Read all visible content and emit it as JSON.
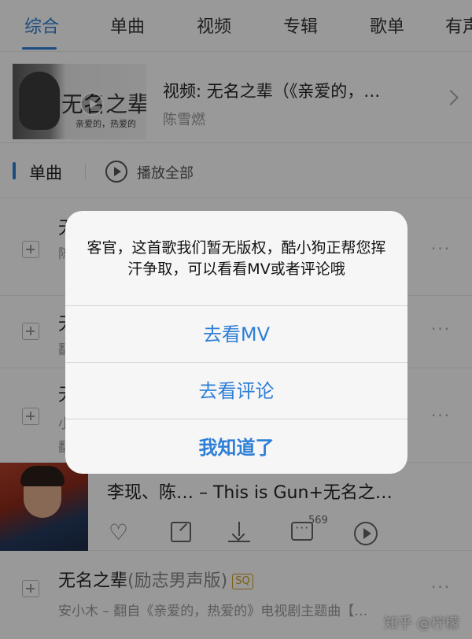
{
  "tabs": [
    "综合",
    "单曲",
    "视频",
    "专辑",
    "歌单",
    "有声"
  ],
  "video": {
    "thumb_title": "无名之辈",
    "thumb_subtitle": "亲爱的，热爱的",
    "title": "视频: 无名之辈（《亲爱的，…",
    "artist": "陈雪燃"
  },
  "section": {
    "title": "单曲",
    "play_all": "播放全部"
  },
  "songs": [
    {
      "title": "无",
      "sub": "陈"
    },
    {
      "title": "无",
      "sub": "翻"
    },
    {
      "title": "无",
      "sub": "小",
      "sub2": "翻"
    },
    {
      "title": "无名之辈",
      "title_suffix": "(励志男声版)",
      "badge": "SQ",
      "sub": "安小木 – 翻自《亲爱的，热爱的》电视剧主题曲【…"
    }
  ],
  "more_icon": "···",
  "feature": {
    "title": "李现、陈…   – This is Gun+无名之…",
    "comment_count": "569",
    "heart_icon": "♡"
  },
  "watermark": "知乎 @柠檬",
  "alert": {
    "message": "客官，这首歌我们暂无版权，酷小狗正帮您挥汗争取，可以看看MV或者评论哦",
    "buttons": [
      "去看MV",
      "去看评论",
      "我知道了"
    ]
  },
  "colors": {
    "accent": "#2e7fd6",
    "sq_badge": "#d09b1f"
  }
}
